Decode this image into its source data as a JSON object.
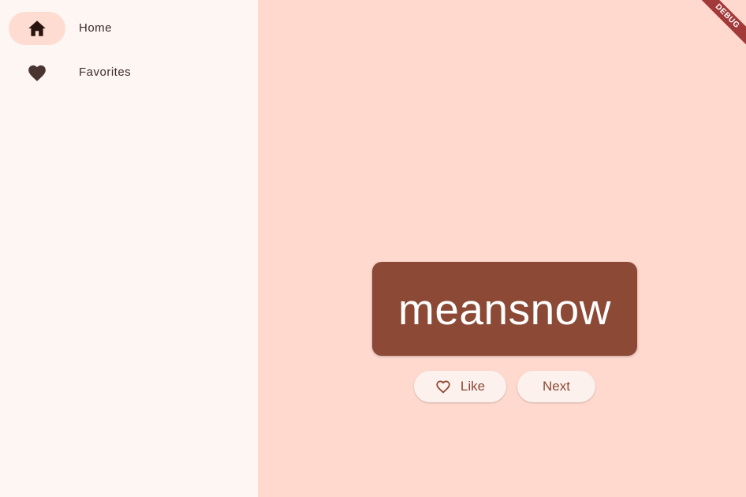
{
  "navigation": {
    "items": [
      {
        "label": "Home",
        "icon": "home-icon",
        "selected": true
      },
      {
        "label": "Favorites",
        "icon": "heart-filled-icon",
        "selected": false
      }
    ]
  },
  "main": {
    "word": "meansnow",
    "like_label": "Like",
    "like_icon": "heart-outline-icon",
    "next_label": "Next"
  },
  "debug_banner": "DEBUG",
  "colors": {
    "rail_background": "#fdf6f3",
    "main_background": "#ffd9ce",
    "selected_indicator": "#ffdcd2",
    "card": "#8c4a36",
    "button_background": "#fdf1ee",
    "debug_ribbon": "#a33a3a"
  }
}
